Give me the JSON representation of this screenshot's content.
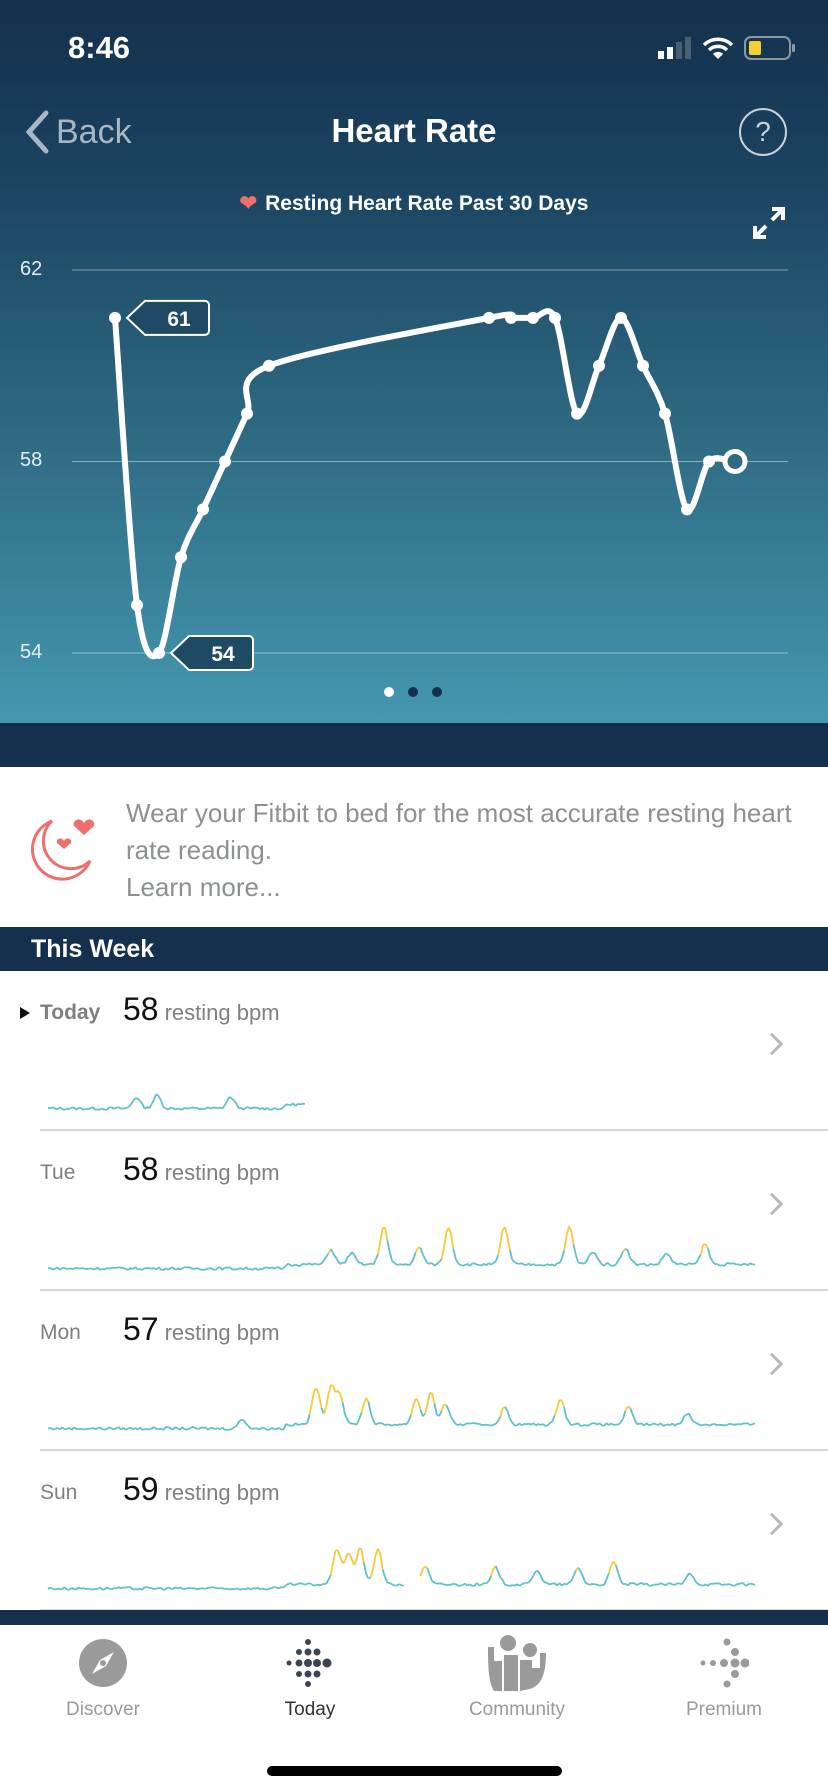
{
  "status_bar": {
    "time": "8:46",
    "signal_icon": "signal-icon",
    "wifi_icon": "wifi-icon",
    "battery_icon": "battery-icon",
    "battery_color": "#f5d033"
  },
  "nav": {
    "back_label": "Back",
    "title": "Heart Rate",
    "help_label": "?"
  },
  "chart_data": {
    "type": "line",
    "title": "Resting Heart Rate Past 30 Days",
    "ylim": [
      54,
      62
    ],
    "yticks": [
      "62",
      "58",
      "54"
    ],
    "x": [
      1,
      2,
      3,
      4,
      5,
      6,
      7,
      8,
      9,
      10,
      11,
      12,
      13,
      14,
      15,
      16,
      17,
      18,
      19,
      20,
      21,
      22,
      23,
      24,
      25,
      26,
      27,
      28,
      29
    ],
    "values": [
      61,
      55,
      54,
      56,
      57,
      58,
      59,
      60,
      null,
      null,
      null,
      null,
      null,
      null,
      null,
      null,
      null,
      61,
      61,
      61,
      61,
      59,
      60,
      61,
      60,
      59,
      57,
      58,
      58
    ],
    "annotations": [
      {
        "label": "61",
        "index": 0
      },
      {
        "label": "54",
        "index": 2
      }
    ],
    "grid": true,
    "line_color": "#ffffff"
  },
  "pager": {
    "pages": 3,
    "active": 1
  },
  "info": {
    "text": "Wear your Fitbit to bed for the most accurate resting heart rate reading.",
    "link": "Learn more...",
    "icon": "moon-heart-icon",
    "icon_color": "#ef6f6c"
  },
  "week": {
    "title": "This Week",
    "unit": "resting bpm",
    "days": [
      {
        "label": "Today",
        "bpm": "58",
        "hours_recorded": 8.75,
        "peaks": [
          [
            3,
            0.3
          ],
          [
            3.7,
            0.35
          ],
          [
            6.2,
            0.3
          ],
          [
            10.8,
            0.35
          ]
        ],
        "yellow_peaks": []
      },
      {
        "label": "Tue",
        "bpm": "58",
        "hours_recorded": 24,
        "peaks": [
          [
            9.6,
            0.4
          ],
          [
            10.3,
            0.3
          ],
          [
            11.4,
            1
          ],
          [
            12.6,
            0.45
          ],
          [
            13.6,
            1
          ],
          [
            15.5,
            1
          ],
          [
            17.7,
            1
          ],
          [
            18.5,
            0.35
          ],
          [
            19.6,
            0.45
          ],
          [
            21,
            0.3
          ],
          [
            22.3,
            0.55
          ]
        ],
        "yellow_peaks": [
          11.4,
          13.6,
          15.5,
          17.7,
          22.3
        ]
      },
      {
        "label": "Mon",
        "bpm": "57",
        "hours_recorded": 24,
        "peaks": [
          [
            6.6,
            0.25
          ],
          [
            9.1,
            1
          ],
          [
            9.6,
            1
          ],
          [
            9.9,
            0.8
          ],
          [
            10.8,
            0.7
          ],
          [
            12.5,
            0.7
          ],
          [
            13,
            0.85
          ],
          [
            13.5,
            0.55
          ],
          [
            15.5,
            0.45
          ],
          [
            17.4,
            0.7
          ],
          [
            19.7,
            0.45
          ],
          [
            21.7,
            0.3
          ]
        ],
        "yellow_peaks": [
          9.1,
          9.6,
          9.9,
          13
        ]
      },
      {
        "label": "Sun",
        "bpm": "59",
        "hours_recorded": 24,
        "gap": [
          12.1,
          12.6
        ],
        "peaks": [
          [
            9.8,
            0.95
          ],
          [
            10.2,
            0.85
          ],
          [
            10.6,
            0.95
          ],
          [
            11.2,
            0.95
          ],
          [
            12.8,
            0.5
          ],
          [
            15.2,
            0.45
          ],
          [
            16.6,
            0.4
          ],
          [
            18,
            0.45
          ],
          [
            19.2,
            0.6
          ],
          [
            21.8,
            0.3
          ]
        ],
        "yellow_peaks": [
          9.8,
          10.2,
          10.6,
          11.2,
          19.2
        ]
      }
    ]
  },
  "tabs": [
    {
      "label": "Discover",
      "icon": "compass-icon",
      "active": false
    },
    {
      "label": "Today",
      "icon": "fitbit-dots-icon",
      "active": true
    },
    {
      "label": "Community",
      "icon": "community-icon",
      "active": false
    },
    {
      "label": "Premium",
      "icon": "premium-dots-icon",
      "active": false
    }
  ]
}
